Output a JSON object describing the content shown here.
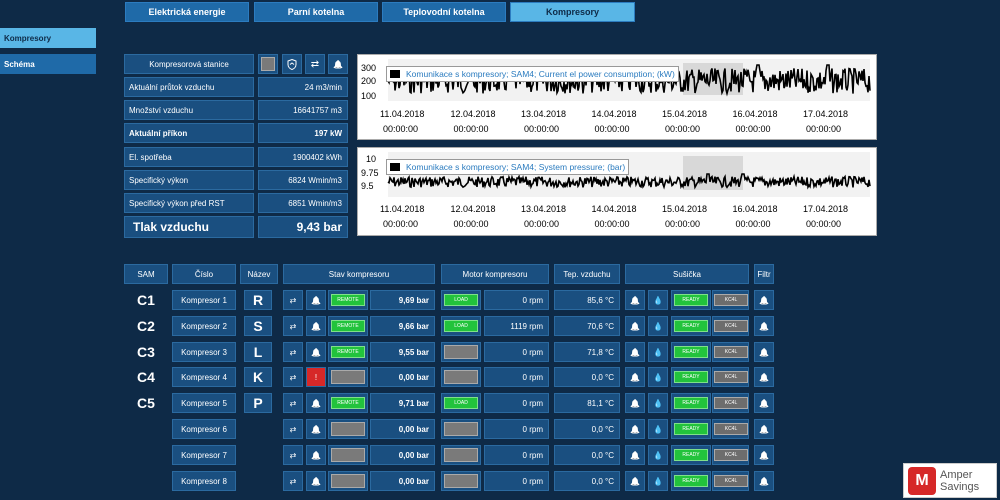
{
  "tabs": [
    {
      "label": "Elektrická energie",
      "active": false
    },
    {
      "label": "Parní kotelna",
      "active": false
    },
    {
      "label": "Teplovodní kotelna",
      "active": false
    },
    {
      "label": "Kompresory",
      "active": true
    }
  ],
  "sidebar": {
    "items": [
      {
        "label": "Kompresory",
        "active": true
      },
      {
        "label": "Schéma",
        "active": false
      }
    ]
  },
  "info": {
    "station_label": "Kompresorová stanice",
    "rows": [
      {
        "label": "Aktuální průtok vzduchu",
        "value": "24 m3/min"
      },
      {
        "label": "Množství vzduchu",
        "value": "16641757 m3"
      },
      {
        "label": "Aktuální příkon",
        "value": "197 kW"
      },
      {
        "label": "El. spotřeba",
        "value": "1900402 kWh"
      },
      {
        "label": "Specifický výkon",
        "value": "6824 Wmin/m3"
      },
      {
        "label": "Specifický výkon před RST",
        "value": "6851 Wmin/m3"
      },
      {
        "label": "Tlak vzduchu",
        "value": "9,43 bar"
      }
    ]
  },
  "charts": [
    {
      "legend": "Komunikace s kompresory; SAM4; Current el power consumption; (kW)",
      "y_ticks": [
        "300",
        "200",
        "100"
      ],
      "x_dates": [
        "11.04.2018",
        "12.04.2018",
        "13.04.2018",
        "14.04.2018",
        "15.04.2018",
        "16.04.2018",
        "17.04.2018"
      ],
      "x_time": "00:00:00"
    },
    {
      "legend": "Komunikace s kompresory; SAM4; System pressure; (bar)",
      "y_ticks": [
        "10",
        "9.75",
        "9.5"
      ],
      "x_dates": [
        "11.04.2018",
        "12.04.2018",
        "13.04.2018",
        "14.04.2018",
        "15.04.2018",
        "16.04.2018",
        "17.04.2018"
      ],
      "x_time": "00:00:00"
    }
  ],
  "table": {
    "headers": {
      "sam": "SAM",
      "cislo": "Číslo",
      "nazev": "Název",
      "stav": "Stav kompresoru",
      "motor": "Motor kompresoru",
      "tep": "Tep. vzduchu",
      "susicka": "Sušička",
      "filtr": "Filtr"
    },
    "rows": [
      {
        "sam": "C1",
        "cislo": "Kompresor 1",
        "nazev": "R",
        "state": "REMOTE",
        "pressure": "9,69 bar",
        "motor_state": "LOAD",
        "rpm": "0 rpm",
        "temp": "85,6 °C",
        "dryer": "READY",
        "kc": "KC4L",
        "alarm": false
      },
      {
        "sam": "C2",
        "cislo": "Kompresor 2",
        "nazev": "S",
        "state": "REMOTE",
        "pressure": "9,66 bar",
        "motor_state": "LOAD",
        "rpm": "1119 rpm",
        "temp": "70,6 °C",
        "dryer": "READY",
        "kc": "KC4L",
        "alarm": false
      },
      {
        "sam": "C3",
        "cislo": "Kompresor 3",
        "nazev": "L",
        "state": "REMOTE",
        "pressure": "9,55 bar",
        "motor_state": "",
        "rpm": "0 rpm",
        "temp": "71,8 °C",
        "dryer": "READY",
        "kc": "KC4L",
        "alarm": false
      },
      {
        "sam": "C4",
        "cislo": "Kompresor 4",
        "nazev": "K",
        "state": "",
        "pressure": "0,00 bar",
        "motor_state": "",
        "rpm": "0 rpm",
        "temp": "0,0 °C",
        "dryer": "READY",
        "kc": "KC4L",
        "alarm": true
      },
      {
        "sam": "C5",
        "cislo": "Kompresor 5",
        "nazev": "P",
        "state": "REMOTE",
        "pressure": "9,71 bar",
        "motor_state": "LOAD",
        "rpm": "0 rpm",
        "temp": "81,1 °C",
        "dryer": "READY",
        "kc": "KC4L",
        "alarm": false
      },
      {
        "sam": "",
        "cislo": "Kompresor 6",
        "nazev": "",
        "state": "",
        "pressure": "0,00 bar",
        "motor_state": "",
        "rpm": "0 rpm",
        "temp": "0,0 °C",
        "dryer": "READY",
        "kc": "KC4L",
        "alarm": false
      },
      {
        "sam": "",
        "cislo": "Kompresor 7",
        "nazev": "",
        "state": "",
        "pressure": "0,00 bar",
        "motor_state": "",
        "rpm": "0 rpm",
        "temp": "0,0 °C",
        "dryer": "READY",
        "kc": "KC4L",
        "alarm": false
      },
      {
        "sam": "",
        "cislo": "Kompresor 8",
        "nazev": "",
        "state": "",
        "pressure": "0,00 bar",
        "motor_state": "",
        "rpm": "0 rpm",
        "temp": "0,0 °C",
        "dryer": "READY",
        "kc": "KC4L",
        "alarm": false
      }
    ]
  },
  "logo": {
    "line1": "Amper",
    "line2": "Savings"
  },
  "colors": {
    "background": "#0e2a47",
    "accent": "#59b6e6",
    "panel": "#1a4f80",
    "green": "#22c33c",
    "alarm": "#d62828"
  }
}
